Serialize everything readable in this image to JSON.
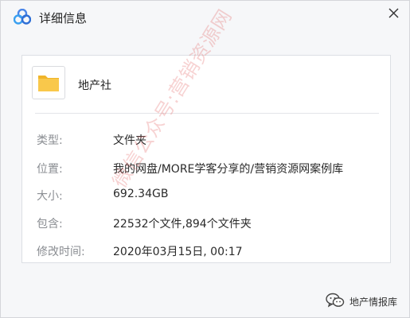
{
  "window": {
    "title": "详细信息",
    "accent_color": "#4a86e8"
  },
  "folder": {
    "icon": "folder-icon",
    "icon_color": "#f9c84b",
    "name": "地产社"
  },
  "details": [
    {
      "label": "类型:",
      "value": "文件夹"
    },
    {
      "label": "位置:",
      "value": "我的网盘/MORE学客分享的/营销资源网案例库"
    },
    {
      "label": "大小:",
      "value": "692.34GB"
    },
    {
      "label": "包含:",
      "value": "22532个文件,894个文件夹"
    },
    {
      "label": "修改时间:",
      "value": "2020年03月15日, 00:17"
    }
  ],
  "watermark": {
    "text": "微信公众号:营销资源网",
    "color": "#e25c5c"
  },
  "badge": {
    "icon": "wechat-icon",
    "text": "地产情报库"
  }
}
